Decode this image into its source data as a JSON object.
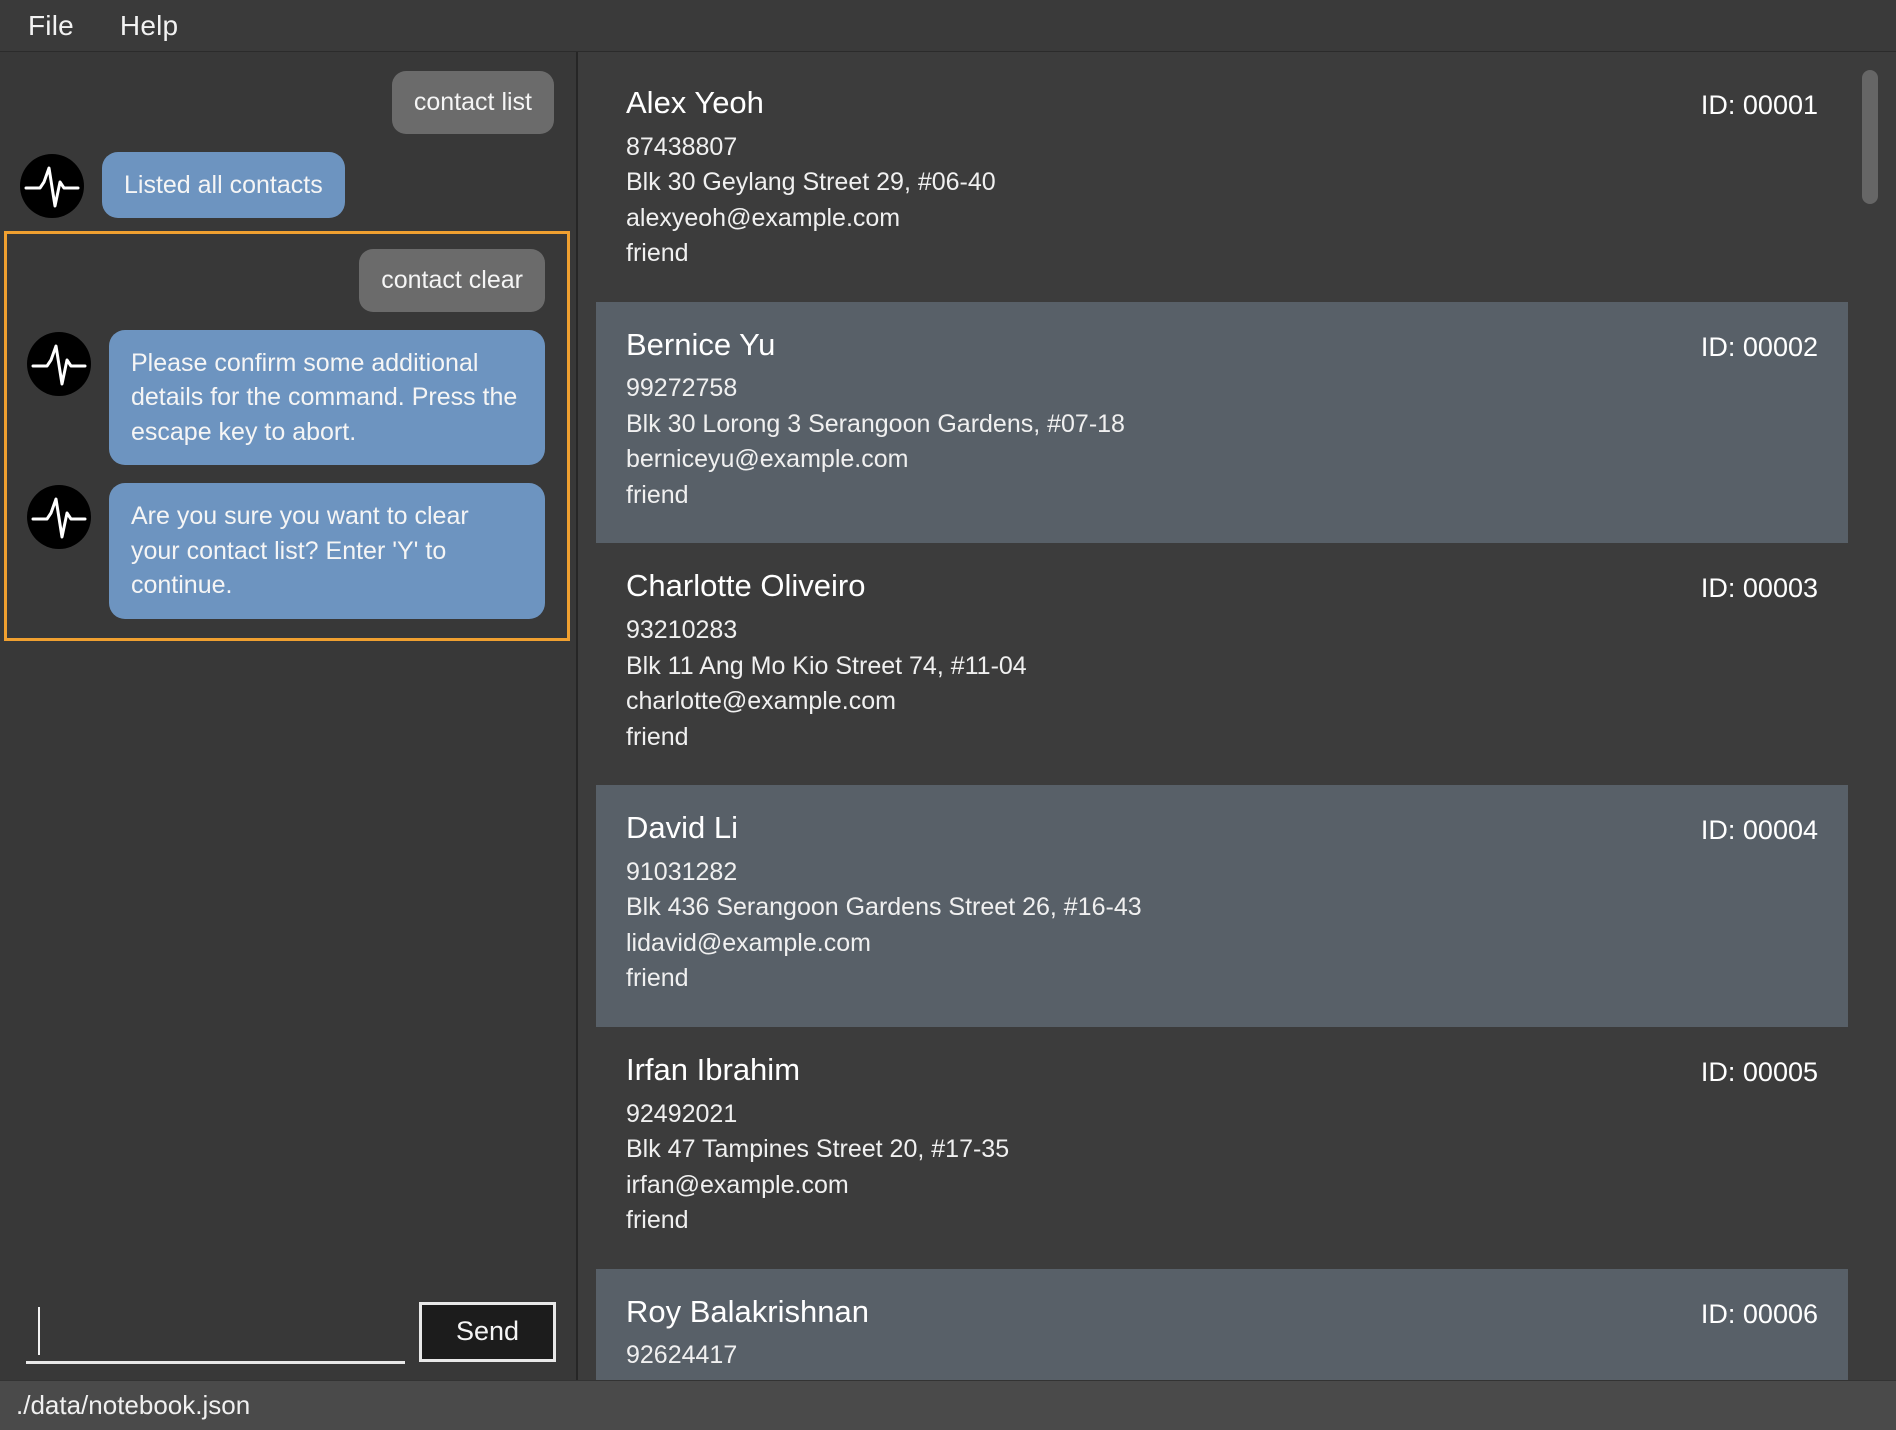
{
  "menubar": {
    "items": [
      {
        "label": "File"
      },
      {
        "label": "Help"
      }
    ]
  },
  "chat": {
    "messages": [
      {
        "role": "user",
        "text": "contact list"
      },
      {
        "role": "bot",
        "text": "Listed all contacts"
      }
    ],
    "highlighted": {
      "messages": [
        {
          "role": "user",
          "text": "contact clear"
        },
        {
          "role": "bot",
          "text": "Please confirm some additional details for the command. Press the escape key to abort."
        },
        {
          "role": "bot",
          "text": "Are you sure you want to clear your contact list? Enter 'Y' to continue."
        }
      ],
      "border_color": "#f0a030"
    },
    "avatar_icon": "heartbeat-icon"
  },
  "composer": {
    "input_value": "",
    "input_placeholder": "",
    "send_label": "Send"
  },
  "contacts": {
    "id_prefix": "ID: ",
    "items": [
      {
        "name": "Alex Yeoh",
        "phone": "87438807",
        "address": "Blk 30 Geylang Street 29, #06-40",
        "email": "alexyeoh@example.com",
        "tag": "friend",
        "id": "ID: 00001"
      },
      {
        "name": "Bernice Yu",
        "phone": "99272758",
        "address": "Blk 30 Lorong 3 Serangoon Gardens, #07-18",
        "email": "berniceyu@example.com",
        "tag": "friend",
        "id": "ID: 00002"
      },
      {
        "name": "Charlotte Oliveiro",
        "phone": "93210283",
        "address": "Blk 11 Ang Mo Kio Street 74, #11-04",
        "email": "charlotte@example.com",
        "tag": "friend",
        "id": "ID: 00003"
      },
      {
        "name": "David Li",
        "phone": "91031282",
        "address": "Blk 436 Serangoon Gardens Street 26, #16-43",
        "email": "lidavid@example.com",
        "tag": "friend",
        "id": "ID: 00004"
      },
      {
        "name": "Irfan Ibrahim",
        "phone": "92492021",
        "address": "Blk 47 Tampines Street 20, #17-35",
        "email": "irfan@example.com",
        "tag": "friend",
        "id": "ID: 00005"
      },
      {
        "name": "Roy Balakrishnan",
        "phone": "92624417",
        "address": "",
        "email": "",
        "tag": "",
        "id": "ID: 00006"
      }
    ]
  },
  "statusbar": {
    "file_path": "./data/notebook.json"
  },
  "colors": {
    "bot_bubble": "#6d94c0",
    "user_bubble": "#6b6b6b",
    "highlight_border": "#f0a030",
    "row_even": "#586068",
    "row_odd": "#3c3c3c",
    "app_background": "#3c3c3c"
  }
}
